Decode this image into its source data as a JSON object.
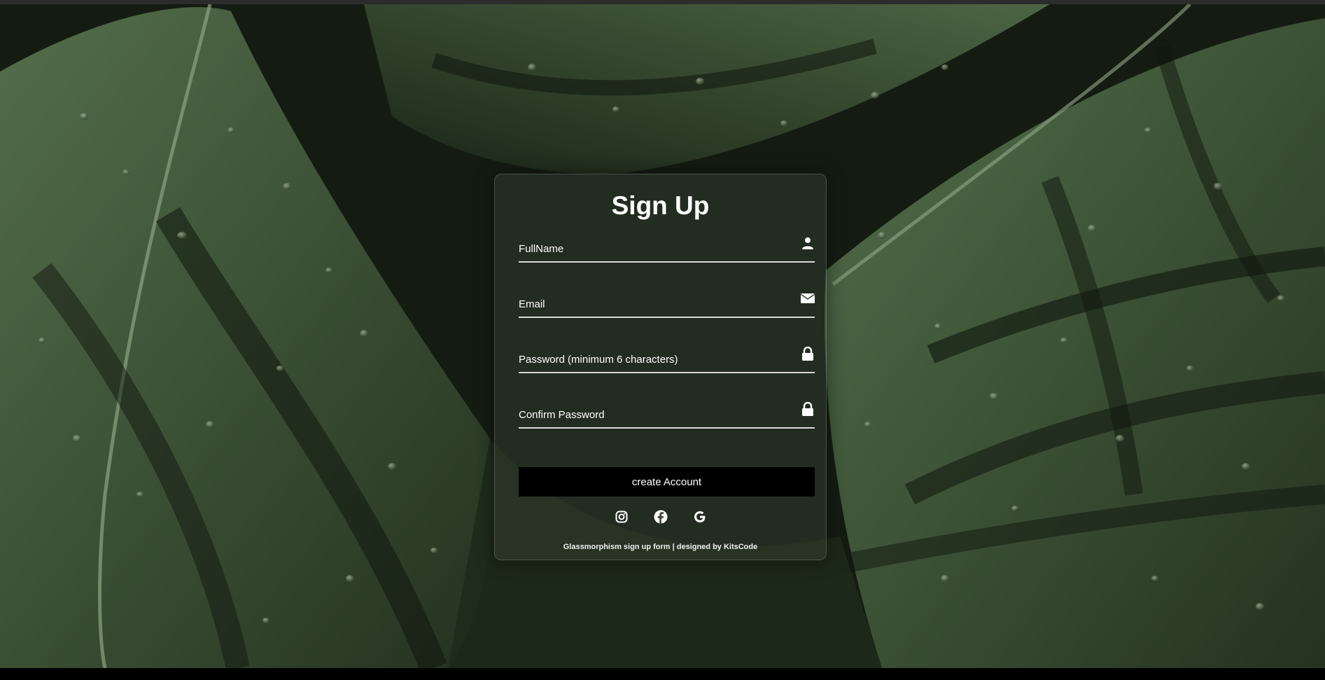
{
  "form": {
    "title": "Sign Up",
    "fields": [
      {
        "placeholder": "FullName",
        "icon": "user-icon"
      },
      {
        "placeholder": "Email",
        "icon": "envelope-icon"
      },
      {
        "placeholder": "Password (minimum 6 characters)",
        "icon": "lock-icon"
      },
      {
        "placeholder": "Confirm Password",
        "icon": "lock-icon"
      }
    ],
    "submit_label": "create Account",
    "social_links": [
      {
        "name": "instagram-icon"
      },
      {
        "name": "facebook-icon"
      },
      {
        "name": "google-icon"
      }
    ],
    "footer": "Glassmorphism sign up form | designed by KitsCode"
  },
  "colors": {
    "button_bg": "#000000",
    "text": "#ffffff",
    "underline": "#d8d8d8",
    "background_leaf": "#2f3f2b"
  }
}
